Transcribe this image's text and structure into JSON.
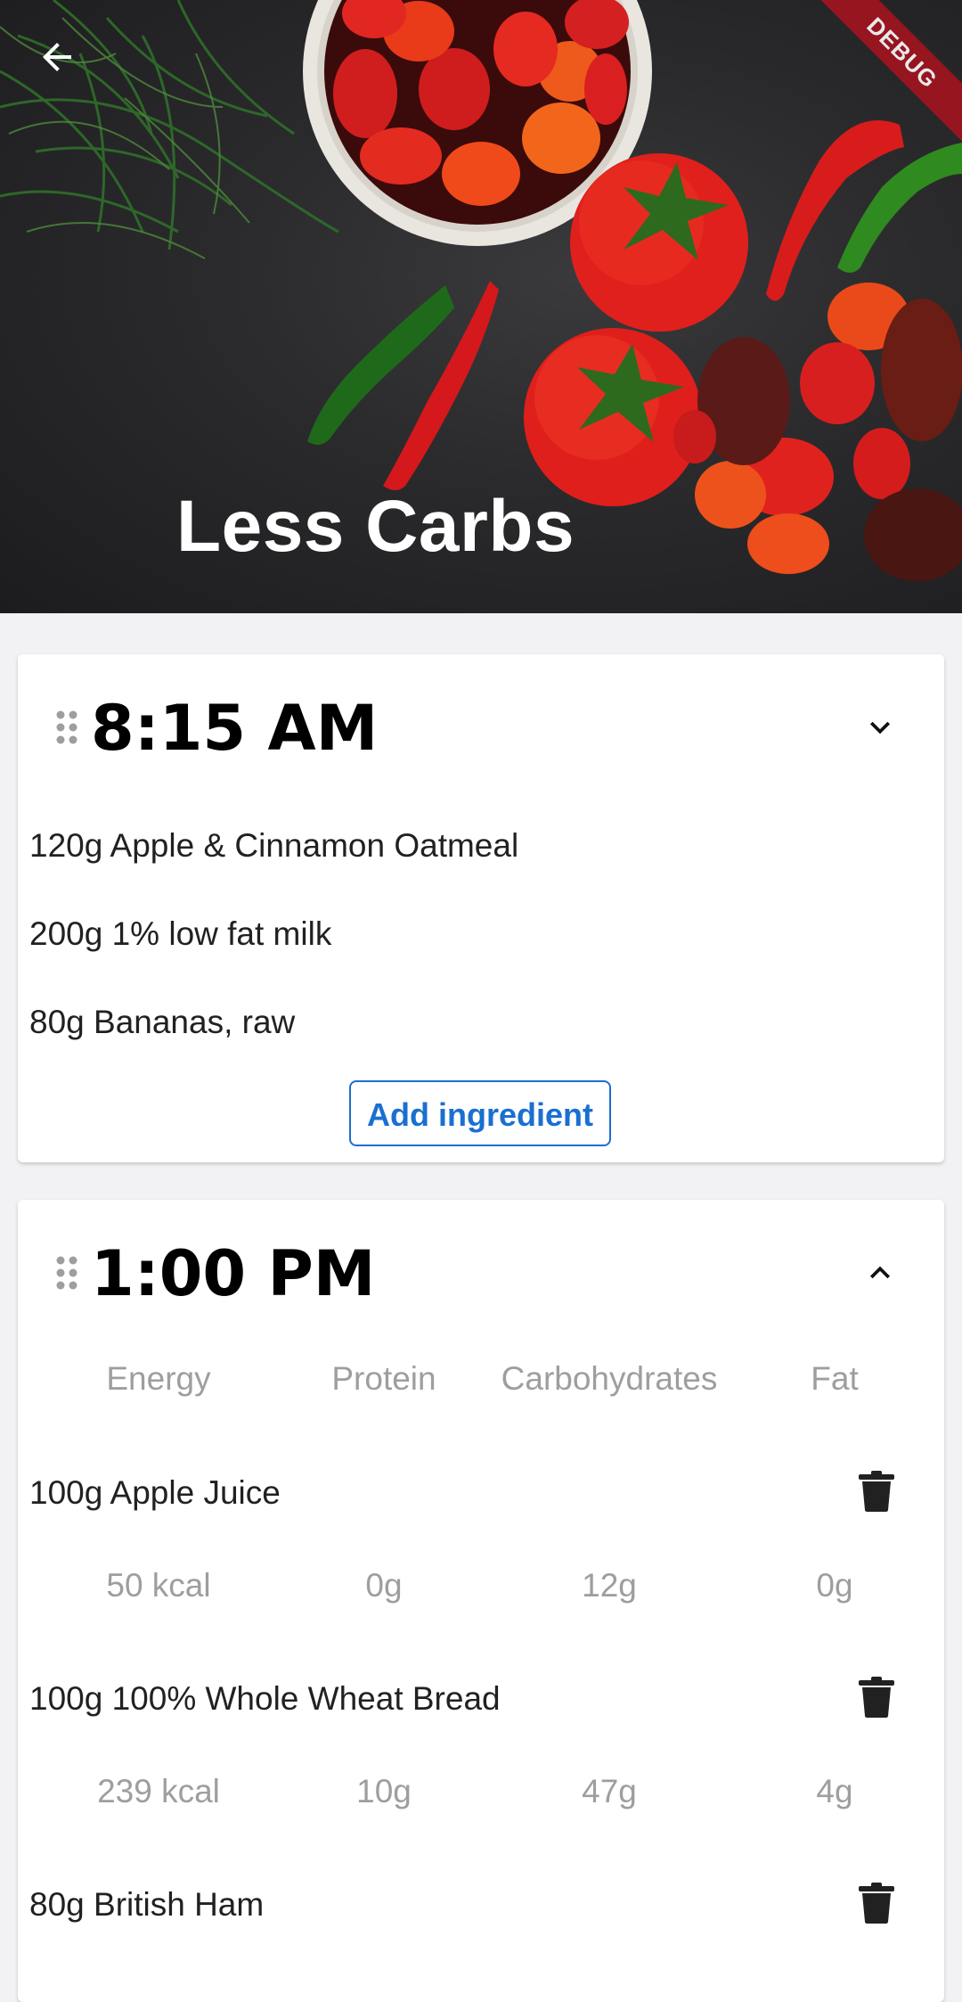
{
  "header": {
    "title": "Less Carbs",
    "back_icon": "arrow-back-icon",
    "debug_banner": "DEBUG"
  },
  "meals": [
    {
      "time": "8:15 AM",
      "expand_icon": "chevron-down-icon",
      "ingredients": [
        "120g Apple & Cinnamon Oatmeal",
        "200g 1% low fat milk",
        "80g Bananas, raw"
      ],
      "add_button": "Add ingredient"
    },
    {
      "time": "1:00 PM",
      "expand_icon": "chevron-up-icon",
      "columns": [
        "Energy",
        "Protein",
        "Carbohydrates",
        "Fat"
      ],
      "items": [
        {
          "name": "100g Apple Juice",
          "energy": "50 kcal",
          "protein": "0g",
          "carbs": "12g",
          "fat": "0g"
        },
        {
          "name": "100g 100% Whole Wheat Bread",
          "energy": "239 kcal",
          "protein": "10g",
          "carbs": "47g",
          "fat": "4g"
        },
        {
          "name": "80g British Ham"
        }
      ]
    }
  ],
  "colors": {
    "accent": "#1a6fd1",
    "muted_text": "#9e9e9e",
    "debug": "#a3141f"
  }
}
